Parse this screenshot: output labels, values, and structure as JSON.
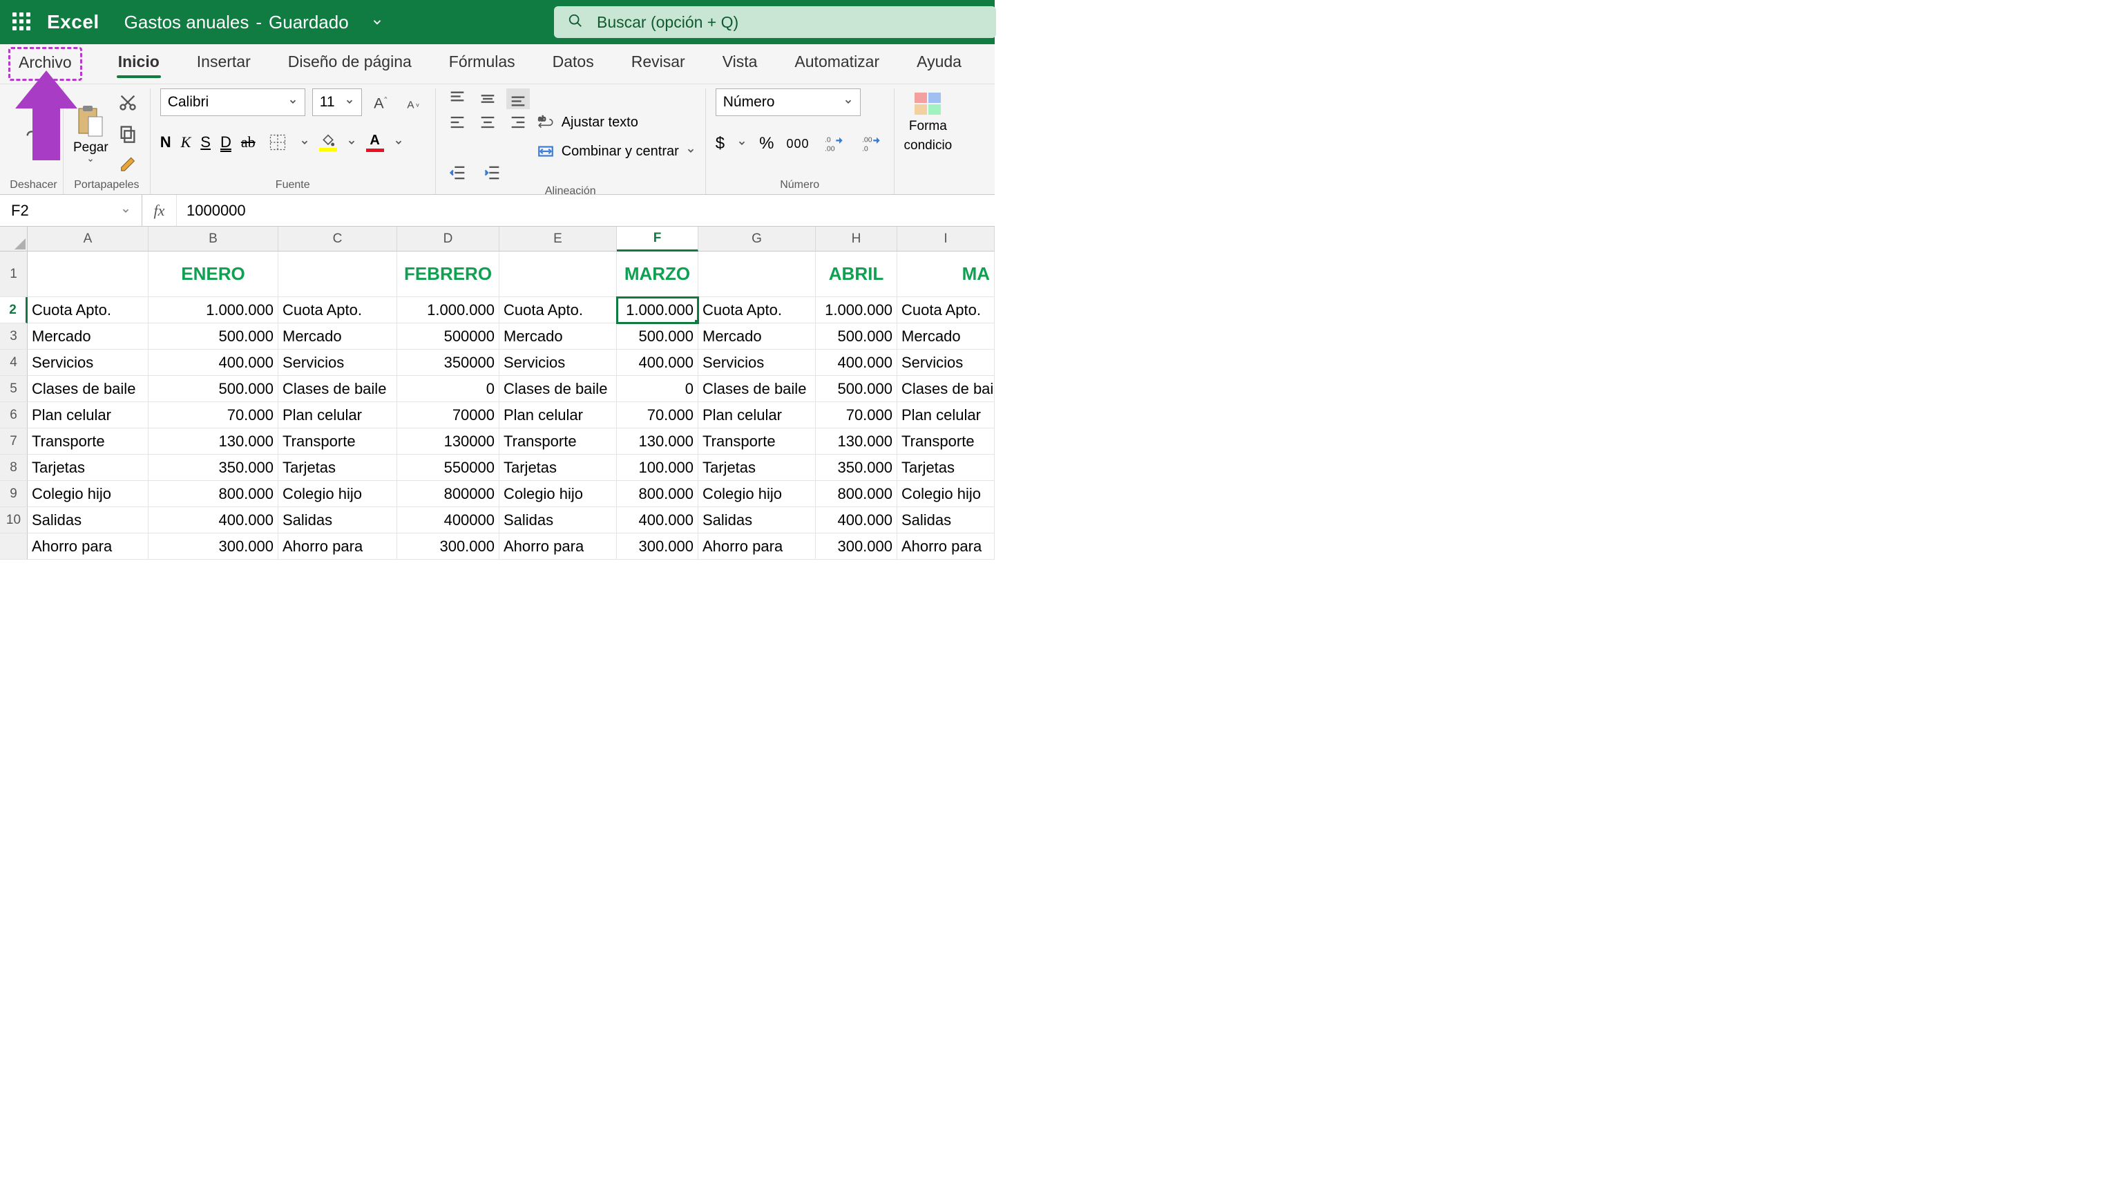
{
  "titlebar": {
    "app_name": "Excel",
    "doc_title": "Gastos anuales",
    "separator": "-",
    "status": "Guardado",
    "search_placeholder": "Buscar (opción + Q)"
  },
  "ribbon_tabs": {
    "archivo": "Archivo",
    "inicio": "Inicio",
    "insertar": "Insertar",
    "diseno": "Diseño de página",
    "formulas": "Fórmulas",
    "datos": "Datos",
    "revisar": "Revisar",
    "vista": "Vista",
    "automatizar": "Automatizar",
    "ayuda": "Ayuda"
  },
  "ribbon": {
    "undo_group": "Deshacer",
    "clipboard_group": "Portapapeles",
    "paste_label": "Pegar",
    "font_group": "Fuente",
    "font_name": "Calibri",
    "font_size": "11",
    "bold": "N",
    "italic": "K",
    "underline": "S",
    "dunderline": "D",
    "strike": "ab",
    "align_group": "Alineación",
    "wrap_text": "Ajustar texto",
    "merge_center": "Combinar y centrar",
    "number_group": "Número",
    "number_format": "Número",
    "currency": "$",
    "percent": "%",
    "thousands": "000",
    "cond_fmt_l1": "Forma",
    "cond_fmt_l2": "condicio"
  },
  "formula_bar": {
    "name_box": "F2",
    "fx": "fx",
    "value": "1000000"
  },
  "columns": [
    "A",
    "B",
    "C",
    "D",
    "E",
    "F",
    "G",
    "H",
    "I"
  ],
  "active_col_index": 5,
  "row_numbers": [
    "1",
    "2",
    "3",
    "4",
    "5",
    "6",
    "7",
    "8",
    "9",
    "10",
    ""
  ],
  "active_row_index": 1,
  "months": {
    "b": "ENERO",
    "d": "FEBRERO",
    "f": "MARZO",
    "h": "ABRIL",
    "i_partial": "MA"
  },
  "rows": [
    {
      "label": "Cuota Apto.",
      "b": "1.000.000",
      "c": "Cuota Apto.",
      "d": "1.000.000",
      "e": "Cuota Apto.",
      "f": "1.000.000",
      "g": "Cuota Apto.",
      "h": "1.000.000",
      "i": "Cuota Apto."
    },
    {
      "label": "Mercado",
      "b": "500.000",
      "c": "Mercado",
      "d": "500000",
      "e": "Mercado",
      "f": "500.000",
      "g": "Mercado",
      "h": "500.000",
      "i": "Mercado"
    },
    {
      "label": "Servicios",
      "b": "400.000",
      "c": "Servicios",
      "d": "350000",
      "e": "Servicios",
      "f": "400.000",
      "g": "Servicios",
      "h": "400.000",
      "i": "Servicios"
    },
    {
      "label": "Clases de baile",
      "b": "500.000",
      "c": "Clases de baile",
      "d": "0",
      "e": "Clases de baile",
      "f": "0",
      "g": "Clases de baile",
      "h": "500.000",
      "i": "Clases de bail"
    },
    {
      "label": "Plan celular",
      "b": "70.000",
      "c": "Plan celular",
      "d": "70000",
      "e": "Plan celular",
      "f": "70.000",
      "g": "Plan celular",
      "h": "70.000",
      "i": "Plan celular"
    },
    {
      "label": "Transporte",
      "b": "130.000",
      "c": "Transporte",
      "d": "130000",
      "e": "Transporte",
      "f": "130.000",
      "g": "Transporte",
      "h": "130.000",
      "i": "Transporte"
    },
    {
      "label": "Tarjetas",
      "b": "350.000",
      "c": "Tarjetas",
      "d": "550000",
      "e": "Tarjetas",
      "f": "100.000",
      "g": "Tarjetas",
      "h": "350.000",
      "i": "Tarjetas"
    },
    {
      "label": "Colegio hijo",
      "b": "800.000",
      "c": "Colegio hijo",
      "d": "800000",
      "e": "Colegio hijo",
      "f": "800.000",
      "g": "Colegio hijo",
      "h": "800.000",
      "i": "Colegio hijo"
    },
    {
      "label": "Salidas",
      "b": "400.000",
      "c": "Salidas",
      "d": "400000",
      "e": "Salidas",
      "f": "400.000",
      "g": "Salidas",
      "h": "400.000",
      "i": "Salidas"
    },
    {
      "label": "Ahorro para",
      "b": "300.000",
      "c": "Ahorro para",
      "d": "300.000",
      "e": "Ahorro para",
      "f": "300.000",
      "g": "Ahorro para",
      "h": "300.000",
      "i": "Ahorro para"
    }
  ]
}
